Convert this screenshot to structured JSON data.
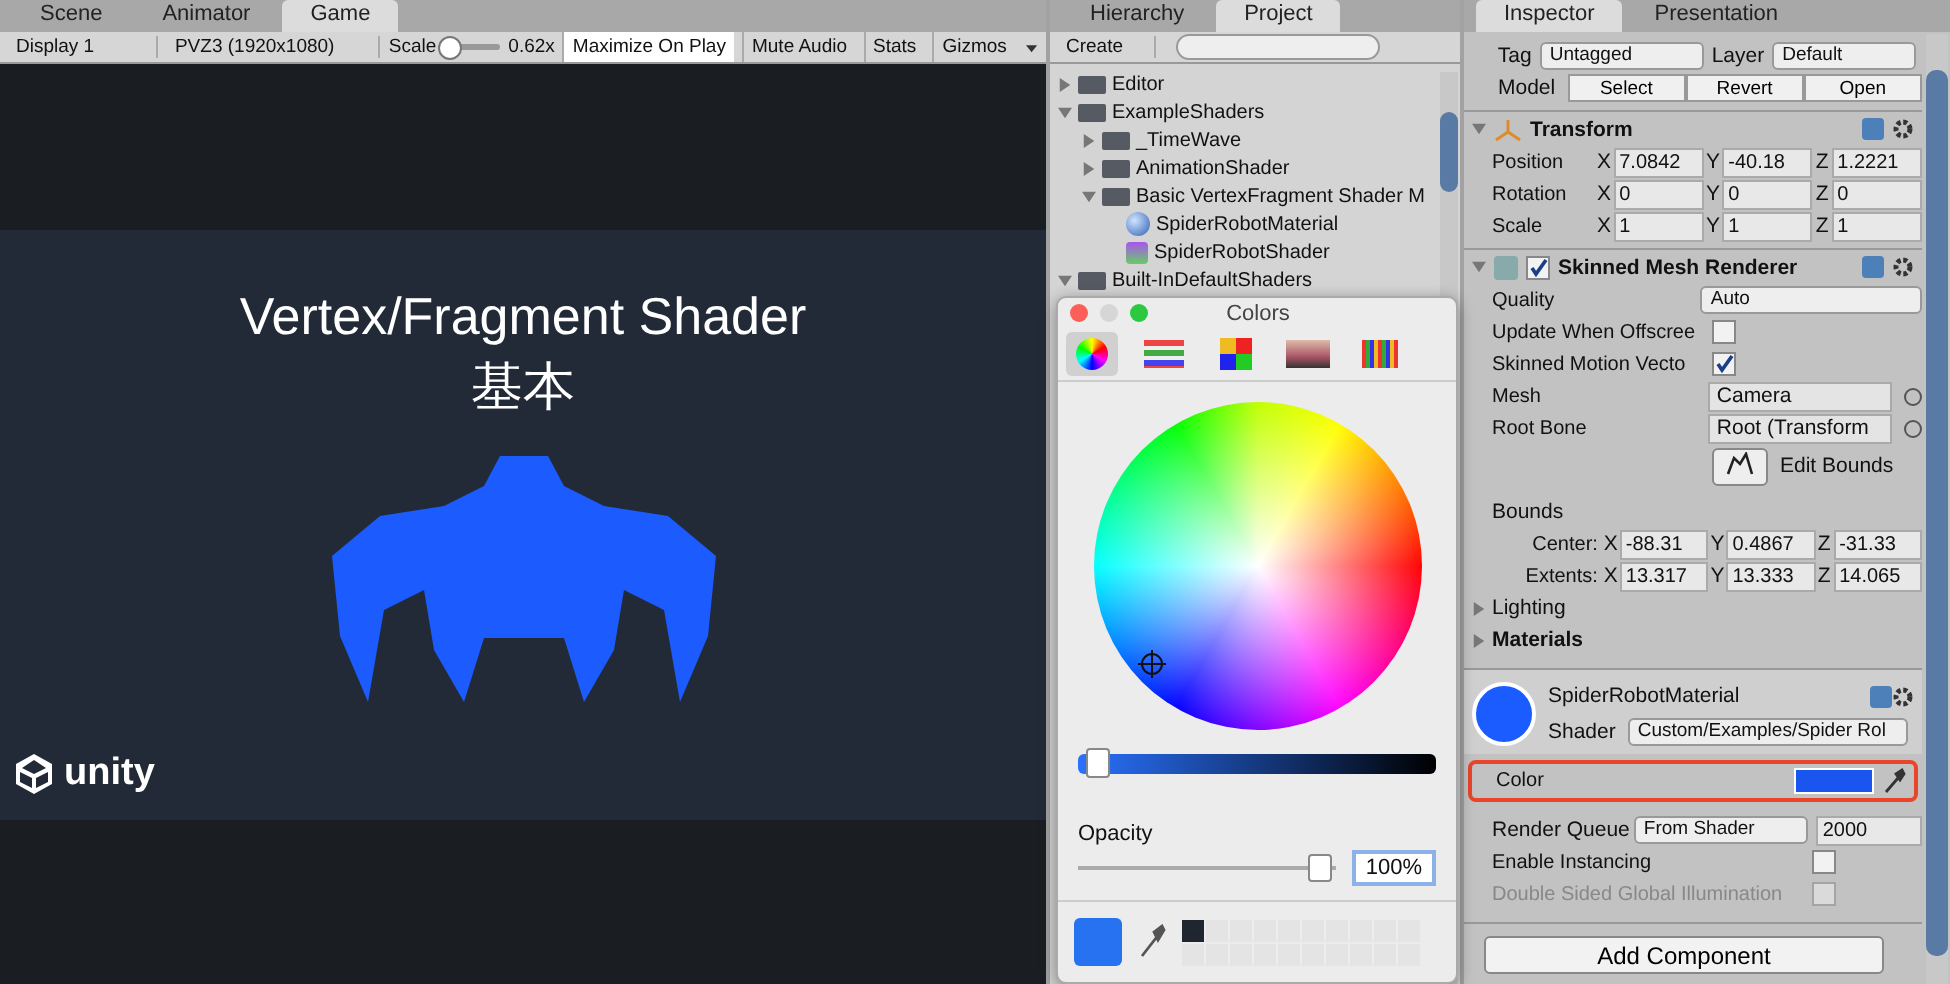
{
  "game": {
    "tabs": [
      {
        "label": "Scene",
        "selected": false
      },
      {
        "label": "Animator",
        "selected": false
      },
      {
        "label": "Game",
        "selected": true
      }
    ],
    "display": "Display 1",
    "resolution": "PVZ3 (1920x1080)",
    "scale_label": "Scale",
    "scale": {
      "level": 0.05
    },
    "scale_value": "0.62x",
    "toggles": [
      {
        "label": "Maximize On Play",
        "on": true
      },
      {
        "label": "Mute Audio",
        "on": false
      },
      {
        "label": "Stats",
        "on": false
      },
      {
        "label": "Gizmos",
        "on": false
      }
    ],
    "title": "Vertex/Fragment Shader",
    "subtitle": "基本",
    "logo": "unity"
  },
  "project": {
    "tabs": [
      {
        "label": "Hierarchy",
        "selected": false
      },
      {
        "label": "Project",
        "selected": true
      }
    ],
    "create": "Create",
    "tree": [
      {
        "label": "Editor",
        "kind": "folder",
        "expanded": false
      },
      {
        "label": "ExampleShaders",
        "kind": "folder",
        "expanded": true,
        "children": [
          {
            "label": "_TimeWave",
            "kind": "folder",
            "expanded": false
          },
          {
            "label": "AnimationShader",
            "kind": "folder",
            "expanded": false
          },
          {
            "label": "Basic VertexFragment Shader M",
            "kind": "folder",
            "expanded": true,
            "children": [
              {
                "label": "SpiderRobotMaterial",
                "kind": "material"
              },
              {
                "label": "SpiderRobotShader",
                "kind": "shader"
              }
            ]
          }
        ]
      },
      {
        "label": "Built-InDefaultShaders",
        "kind": "folder",
        "expanded": true
      }
    ]
  },
  "colors": {
    "title": "Colors",
    "modes": [
      {
        "kind": "wheel",
        "selected": true
      },
      {
        "kind": "sliders",
        "selected": false
      },
      {
        "kind": "palettes",
        "selected": false
      },
      {
        "kind": "image",
        "selected": false
      },
      {
        "kind": "pencils",
        "selected": false
      }
    ],
    "brightness": {
      "level": 0.02
    },
    "opacity_label": "Opacity",
    "opacity": {
      "level": 0.93
    },
    "opacity_value": "100%"
  },
  "inspector": {
    "tabs": [
      {
        "label": "Inspector",
        "selected": true
      },
      {
        "label": "Presentation",
        "selected": false
      }
    ],
    "tag_label": "Tag",
    "tag": "Untagged",
    "layer_label": "Layer",
    "layer": "Default",
    "model_label": "Model",
    "model_buttons": [
      "Select",
      "Revert",
      "Open"
    ],
    "transform": {
      "title": "Transform",
      "expanded": true,
      "rows": [
        {
          "label": "Position",
          "values": [
            {
              "axis": "X",
              "value": "7.0842"
            },
            {
              "axis": "Y",
              "value": "-40.18"
            },
            {
              "axis": "Z",
              "value": "1.2221"
            }
          ]
        },
        {
          "label": "Rotation",
          "values": [
            {
              "axis": "X",
              "value": "0"
            },
            {
              "axis": "Y",
              "value": "0"
            },
            {
              "axis": "Z",
              "value": "0"
            }
          ]
        },
        {
          "label": "Scale",
          "values": [
            {
              "axis": "X",
              "value": "1"
            },
            {
              "axis": "Y",
              "value": "1"
            },
            {
              "axis": "Z",
              "value": "1"
            }
          ]
        }
      ]
    },
    "renderer": {
      "title": "Skinned Mesh Renderer",
      "expanded": true,
      "enabled": true,
      "props": [
        {
          "kind": "dropdown",
          "label": "Quality",
          "value": "Auto"
        },
        {
          "kind": "check",
          "label": "Update When Offscree",
          "checked": false,
          "disabled": false
        },
        {
          "kind": "check",
          "label": "Skinned Motion Vecto",
          "checked": true,
          "disabled": false
        },
        {
          "kind": "object",
          "label": "Mesh",
          "value": "Camera"
        },
        {
          "kind": "object",
          "label": "Root Bone",
          "value": "Root (Transform"
        },
        {
          "kind": "button",
          "label": "Edit Bounds"
        },
        {
          "kind": "heading",
          "label": "Bounds"
        },
        {
          "kind": "vector",
          "label": "Center:",
          "values": [
            {
              "axis": "X",
              "value": "-88.31"
            },
            {
              "axis": "Y",
              "value": "0.4867"
            },
            {
              "axis": "Z",
              "value": "-31.33"
            }
          ]
        },
        {
          "kind": "vector",
          "label": "Extents:",
          "values": [
            {
              "axis": "X",
              "value": "13.317"
            },
            {
              "axis": "Y",
              "value": "13.333"
            },
            {
              "axis": "Z",
              "value": "14.065"
            }
          ]
        },
        {
          "kind": "foldout",
          "label": "Lighting",
          "bold": false
        },
        {
          "kind": "foldout",
          "label": "Materials",
          "bold": true
        }
      ]
    },
    "material": {
      "title": "SpiderRobotMaterial",
      "shader_label": "Shader",
      "shader": "Custom/Examples/Spider Rol",
      "props": [
        {
          "kind": "color",
          "label": "Color",
          "highlighted": true
        },
        {
          "kind": "queue",
          "label": "Render Queue",
          "value": "From Shader",
          "number": "2000"
        },
        {
          "kind": "check",
          "label": "Enable Instancing",
          "checked": false,
          "disabled": false
        },
        {
          "kind": "check",
          "label": "Double Sided Global Illumination",
          "checked": false,
          "disabled": true
        }
      ]
    },
    "add_button": "Add Component"
  }
}
